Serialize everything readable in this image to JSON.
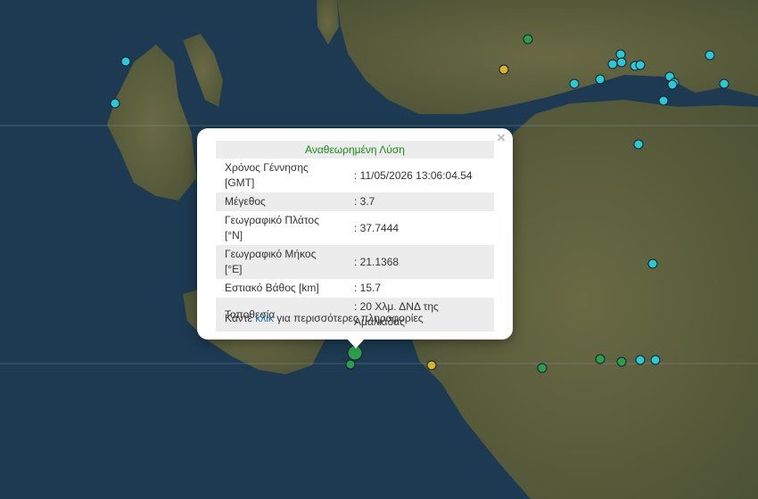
{
  "colors": {
    "sea": "#1d3a52",
    "land": "#5c5f3c",
    "marker_cyan": "#2ec7d4",
    "marker_green": "#2e9e4e",
    "marker_yellow": "#d9b22e",
    "title_green": "#1a8a1a",
    "link_blue": "#1f6fb5"
  },
  "popup": {
    "close_symbol": "×",
    "title": "Αναθεωρημένη Λύση",
    "rows": [
      {
        "label": "Χρόνος Γέννησης [GMT]",
        "value": ": 11/05/2026 13:06:04.54"
      },
      {
        "label": "Μέγεθος",
        "value": ": 3.7"
      },
      {
        "label": "Γεωγραφικό Πλάτος [°N]",
        "value": ": 37.7444"
      },
      {
        "label": "Γεωγραφικό Μήκος [°E]",
        "value": ": 21.1368"
      },
      {
        "label": "Εστιακό Βάθος [km]",
        "value": ": 15.7"
      },
      {
        "label": "Τοποθεσία",
        "value": ": 20 Χλμ. ΔΝΔ της Αμαλιάδας"
      }
    ],
    "more_prefix": "Κάντε ",
    "more_link": "κλικ",
    "more_suffix": " για περισσότερες πληροφορίες"
  }
}
